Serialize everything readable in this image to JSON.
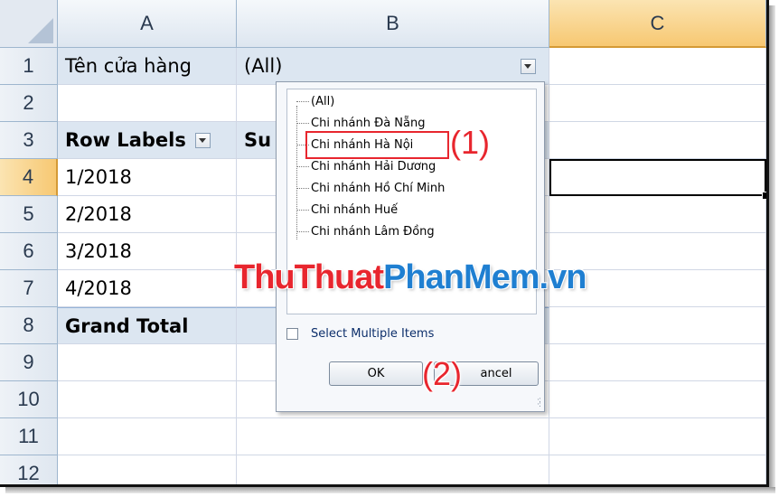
{
  "sheet": {
    "columns": [
      {
        "label": "A",
        "selected": false
      },
      {
        "label": "B",
        "selected": false
      },
      {
        "label": "C",
        "selected": true
      }
    ],
    "rows": [
      "1",
      "2",
      "3",
      "4",
      "5",
      "6",
      "7",
      "8",
      "9",
      "10",
      "11",
      "12"
    ],
    "selected_row": "4",
    "cells": {
      "a1": "Tên cửa hàng",
      "b1": "(All)",
      "a3": "Row Labels",
      "b3": "Su",
      "a4": "1/2018",
      "a5": "2/2018",
      "a6": "3/2018",
      "a7": "4/2018",
      "a8": "Grand Total"
    }
  },
  "filter_dropdown": {
    "items": [
      "(All)",
      "Chi nhánh Đà Nẵng",
      "Chi nhánh Hà Nội",
      "Chi nhánh Hải Dương",
      "Chi nhánh Hồ Chí Minh",
      "Chi nhánh Huế",
      "Chi nhánh Lâm Đồng"
    ],
    "selected_item": "Chi nhánh Hà Nội",
    "select_multiple_label": "Select Multiple Items",
    "select_multiple_checked": false,
    "ok_label": "OK",
    "cancel_label": "Cancel",
    "cancel_visible_text": "ancel"
  },
  "annotations": {
    "step1": "(1)",
    "step2": "(2)",
    "highlight_color": "#e8262e"
  },
  "watermark": {
    "part1": "ThuThuat",
    "part2": "PhanMem",
    "part3": ".vn"
  },
  "colors": {
    "header_bg": "#dde6f0",
    "selected_header": "#f7c872",
    "band": "#dce6f1",
    "watermark_red": "#e8262e",
    "watermark_blue": "#1f7fd1"
  }
}
